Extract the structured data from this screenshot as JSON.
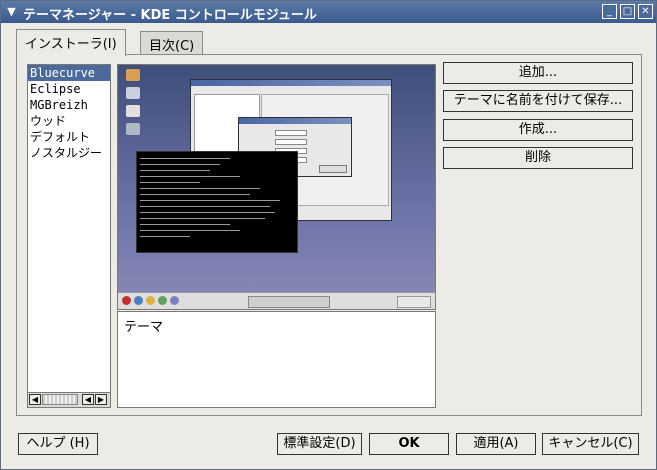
{
  "window": {
    "title": "テーマネージャー - KDE コントロールモジュール",
    "controls": [
      "chevron-down-icon",
      "minimize-icon",
      "maximize-icon",
      "close-icon"
    ]
  },
  "tabs": [
    {
      "label": "インストーラ(I)",
      "active": true
    },
    {
      "label": "目次(C)",
      "active": false
    }
  ],
  "theme_list": {
    "items": [
      "Bluecurve",
      "Eclipse",
      "MGBreizh",
      "ウッド",
      "デフォルト",
      "ノスタルジー"
    ],
    "selected": "Bluecurve"
  },
  "description": {
    "text": "テーマ"
  },
  "actions": {
    "add": "追加...",
    "save_as": "テーマに名前を付けて保存...",
    "create": "作成...",
    "delete": "削除"
  },
  "footer": {
    "help": "ヘルプ (H)",
    "defaults": "標準設定(D)",
    "ok": "OK",
    "apply": "適用(A)",
    "cancel": "キャンセル(C)"
  },
  "colors": {
    "selection": "#4b6a9b",
    "titlebar": "#3a5a8e"
  }
}
